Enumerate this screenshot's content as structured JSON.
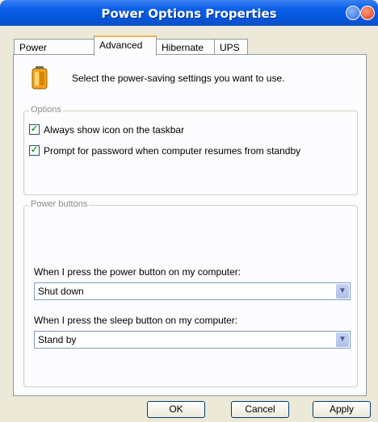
{
  "window": {
    "title": "Power Options Properties"
  },
  "tabs": [
    {
      "label": "Power Schemes"
    },
    {
      "label": "Advanced"
    },
    {
      "label": "Hibernate"
    },
    {
      "label": "UPS"
    }
  ],
  "advanced": {
    "intro": "Select the power-saving settings you want to use.",
    "options": {
      "label": "Options",
      "items": [
        {
          "label": "Always show icon on the taskbar",
          "checked": true
        },
        {
          "label": "Prompt for password when computer resumes from standby",
          "checked": true
        }
      ]
    },
    "power_buttons": {
      "label": "Power buttons",
      "power_label": "When I press the power button on my computer:",
      "power_value": "Shut down",
      "sleep_label": "When I press the sleep button on my computer:",
      "sleep_value": "Stand by"
    }
  },
  "buttons": {
    "ok": "OK",
    "cancel": "Cancel",
    "apply": "Apply"
  },
  "colors": {
    "titlebar": "#0a5fe8",
    "check": "#21a121",
    "tab_highlight": "#f3b54b"
  }
}
